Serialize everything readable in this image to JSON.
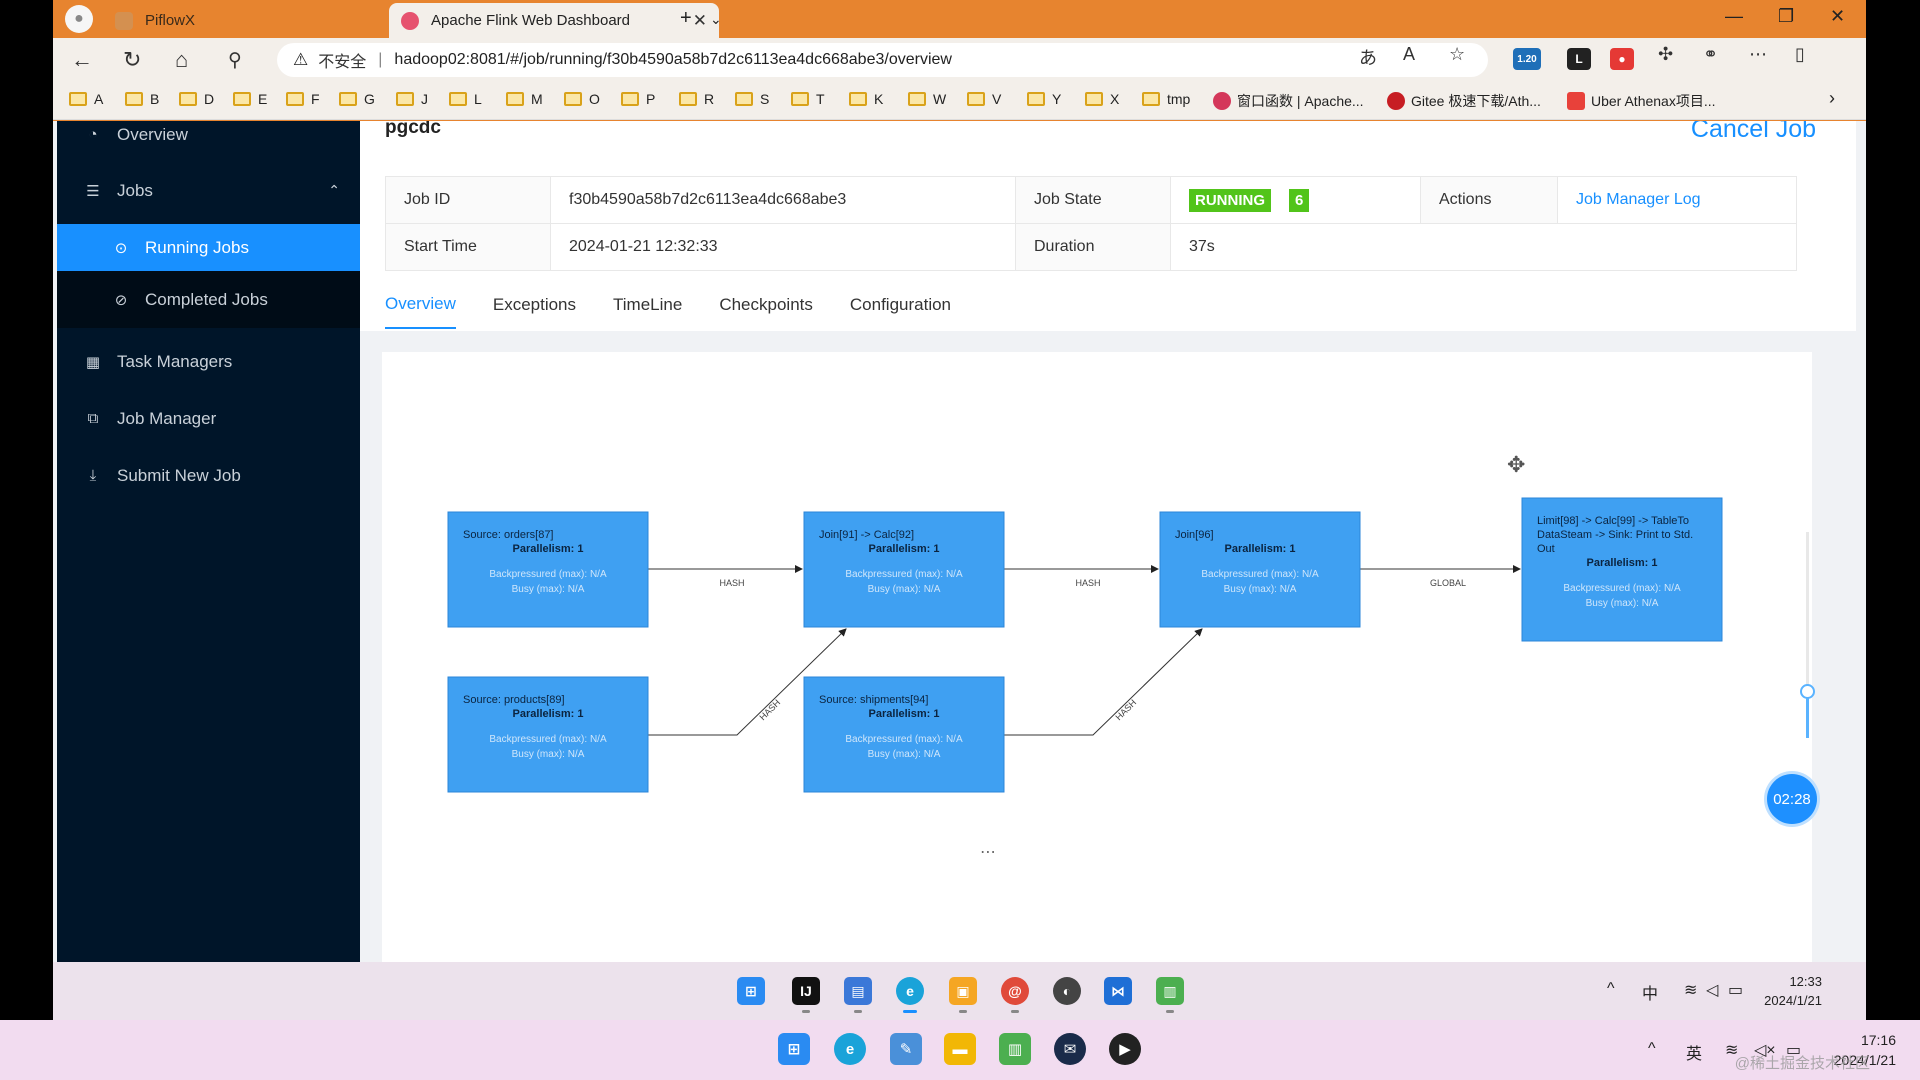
{
  "browser": {
    "tabs": [
      {
        "label": "PiflowX",
        "active": false
      },
      {
        "label": "Apache Flink Web Dashboard",
        "active": true
      }
    ],
    "address": {
      "security_label": "不安全",
      "url": "hadoop02:8081/#/job/running/f30b4590a58b7d2c6113ea4dc668abe3/overview",
      "extension_badge": "1.20"
    },
    "bookmarks": [
      "A",
      "B",
      "D",
      "E",
      "F",
      "G",
      "J",
      "L",
      "M",
      "O",
      "P",
      "R",
      "S",
      "T",
      "K",
      "W",
      "V",
      "Y",
      "X",
      "tmp",
      "窗口函数 | Apache...",
      "Gitee 极速下载/Ath...",
      "Uber Athenax项目..."
    ]
  },
  "sidebar": {
    "items": [
      {
        "label": "Overview",
        "icon": "dashboard-icon"
      },
      {
        "label": "Jobs",
        "icon": "list-icon"
      },
      {
        "label": "Running Jobs",
        "icon": "play-circle-icon"
      },
      {
        "label": "Completed Jobs",
        "icon": "check-circle-icon"
      },
      {
        "label": "Task Managers",
        "icon": "schedule-icon"
      },
      {
        "label": "Job Manager",
        "icon": "cluster-icon"
      },
      {
        "label": "Submit New Job",
        "icon": "upload-icon"
      }
    ]
  },
  "job": {
    "name": "pgcdc",
    "cancel_label": "Cancel Job",
    "id_label": "Job ID",
    "id": "f30b4590a58b7d2c6113ea4dc668abe3",
    "state_label": "Job State",
    "state": "RUNNING",
    "running_count": "6",
    "actions_label": "Actions",
    "actions_link": "Job Manager Log",
    "start_label": "Start Time",
    "start": "2024-01-21 12:32:33",
    "duration_label": "Duration",
    "duration": "37s"
  },
  "page_tabs": [
    "Overview",
    "Exceptions",
    "TimeLine",
    "Checkpoints",
    "Configuration"
  ],
  "graph": {
    "nodes": [
      {
        "id": "n1",
        "lines": [
          "Source: orders[87]"
        ],
        "parallelism": "Parallelism: 1",
        "backpressure": "Backpressured (max): N/A",
        "busy": "Busy (max): N/A"
      },
      {
        "id": "n2",
        "lines": [
          "Join[91] -> Calc[92]"
        ],
        "parallelism": "Parallelism: 1",
        "backpressure": "Backpressured (max): N/A",
        "busy": "Busy (max): N/A"
      },
      {
        "id": "n3",
        "lines": [
          "Join[96]"
        ],
        "parallelism": "Parallelism: 1",
        "backpressure": "Backpressured (max): N/A",
        "busy": "Busy (max): N/A"
      },
      {
        "id": "n4",
        "lines": [
          "Limit[98] -> Calc[99] -> TableTo",
          "DataSteam -> Sink: Print to Std.",
          "Out"
        ],
        "parallelism": "Parallelism: 1",
        "backpressure": "Backpressured (max): N/A",
        "busy": "Busy (max): N/A"
      },
      {
        "id": "n5",
        "lines": [
          "Source: products[89]"
        ],
        "parallelism": "Parallelism: 1",
        "backpressure": "Backpressured (max): N/A",
        "busy": "Busy (max): N/A"
      },
      {
        "id": "n6",
        "lines": [
          "Source: shipments[94]"
        ],
        "parallelism": "Parallelism: 1",
        "backpressure": "Backpressured (max): N/A",
        "busy": "Busy (max): N/A"
      }
    ],
    "edges": [
      {
        "label": "HASH"
      },
      {
        "label": "HASH"
      },
      {
        "label": "GLOBAL"
      },
      {
        "label": "HASH"
      },
      {
        "label": "HASH"
      }
    ],
    "node_color": "#3fa0f2",
    "timer": "02:28"
  },
  "inner_taskbar": {
    "clock_time": "12:33",
    "clock_date": "2024/1/21",
    "ime": "中"
  },
  "outer_taskbar": {
    "clock_time": "17:16",
    "clock_date": "2024/1/21",
    "ime": "英",
    "watermark": "@稀土掘金技术社区"
  }
}
